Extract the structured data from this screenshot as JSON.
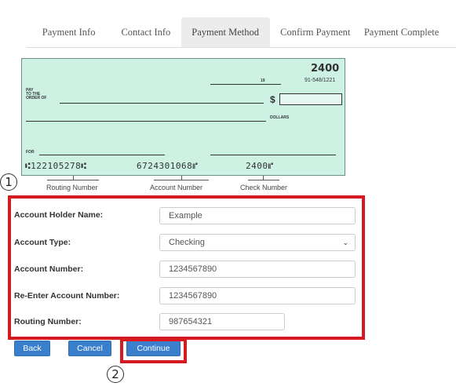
{
  "tabs": [
    {
      "label": "Payment Info"
    },
    {
      "label": "Contact Info"
    },
    {
      "label": "Payment Method",
      "active": true
    },
    {
      "label": "Confirm Payment"
    },
    {
      "label": "Payment Complete"
    }
  ],
  "check": {
    "number": "2400",
    "date_suffix": "19",
    "fraction_code": "91-548/1221",
    "pay_to_label": "PAY\nTO THE\nORDER OF",
    "dollar_sign": "$",
    "dollars_label": "DOLLARS",
    "for_label": "FOR",
    "micr_routing": "⑆122105278⑆",
    "micr_account": "6724301068⑈",
    "micr_check": "2400⑈",
    "background_color": "#cdf2e4"
  },
  "callouts": {
    "routing": "Routing Number",
    "account": "Account Number",
    "check": "Check Number"
  },
  "markers": {
    "one": "1",
    "two": "2"
  },
  "form": {
    "account_holder_label": "Account Holder Name:",
    "account_holder_value": "Example",
    "account_type_label": "Account Type:",
    "account_type_value": "Checking",
    "account_number_label": "Account Number:",
    "account_number_value": "1234567890",
    "reenter_label": "Re-Enter Account Number:",
    "reenter_value": "1234567890",
    "routing_label": "Routing Number:",
    "routing_value": "987654321"
  },
  "buttons": {
    "back": "Back",
    "cancel": "Cancel",
    "continue": "Continue"
  },
  "colors": {
    "highlight": "#d71920",
    "button": "#3a7fcc"
  }
}
